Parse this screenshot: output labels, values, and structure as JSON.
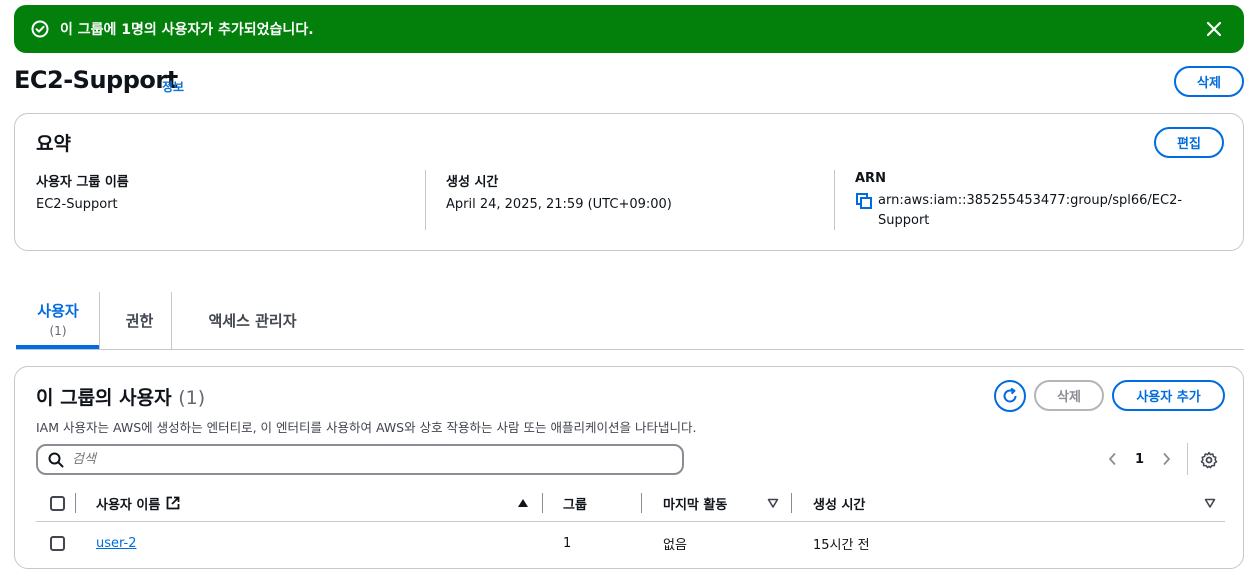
{
  "flash": {
    "message": "이 그룹에 1명의 사용자가 추가되었습니다."
  },
  "header": {
    "title": "EC2-Support",
    "info": "정보",
    "delete_label": "삭제"
  },
  "summary": {
    "title": "요약",
    "edit_label": "편집",
    "group_name_label": "사용자 그룹 이름",
    "group_name_value": "EC2-Support",
    "created_label": "생성 시간",
    "created_value": "April 24, 2025, 21:59 (UTC+09:00)",
    "arn_label": "ARN",
    "arn_value": "arn:aws:iam::385255453477:group/spl66/EC2-Support"
  },
  "tabs": [
    {
      "label": "사용자",
      "count": "(1)"
    },
    {
      "label": "권한"
    },
    {
      "label": "액세스 관리자"
    }
  ],
  "users": {
    "title": "이 그룹의 사용자",
    "count": "(1)",
    "description": "IAM 사용자는 AWS에 생성하는 엔터티로, 이 엔터티를 사용하여 AWS와 상호 작용하는 사람 또는 애플리케이션을 나타냅니다.",
    "delete_label": "삭제",
    "add_label": "사용자 추가",
    "search_placeholder": "검색",
    "page": "1",
    "columns": [
      "사용자 이름",
      "그룹",
      "마지막 활동",
      "생성 시간"
    ],
    "rows": [
      {
        "name": "user-2",
        "groups": "1",
        "last_activity": "없음",
        "created": "15시간 전"
      }
    ]
  },
  "colors": {
    "accent": "#006ce0",
    "success": "#037f0c",
    "border": "#c6c6cd"
  }
}
